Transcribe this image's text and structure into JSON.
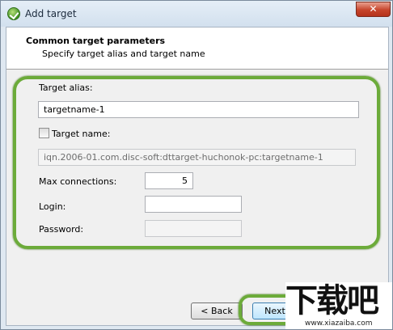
{
  "window": {
    "title": "Add target",
    "close_glyph": "✕"
  },
  "header": {
    "title": "Common target parameters",
    "subtitle": "Specify target alias and target name"
  },
  "form": {
    "alias_label": "Target alias:",
    "alias_value": "targetname-1",
    "target_name_label": "Target name:",
    "target_name_checked": false,
    "target_name_value": "iqn.2006-01.com.disc-soft:dttarget-huchonok-pc:targetname-1",
    "max_connections_label": "Max connections:",
    "max_connections_value": "5",
    "login_label": "Login:",
    "login_value": "",
    "password_label": "Password:",
    "password_value": ""
  },
  "buttons": {
    "back": "< Back",
    "next": "Next"
  },
  "watermark": {
    "logo_text": "下载吧",
    "url": "www.xiazaiba.com"
  },
  "colors": {
    "highlight": "#6cab3a",
    "close": "#c6442b"
  },
  "icons": {
    "app": "app-check-icon",
    "close": "close-icon"
  }
}
